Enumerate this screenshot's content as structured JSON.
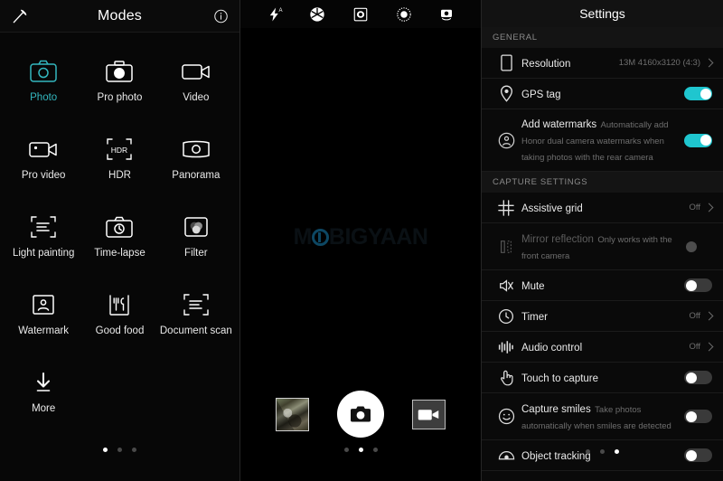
{
  "modes_panel": {
    "title": "Modes",
    "left_icon": "magic-wand-icon",
    "right_icon": "info-icon",
    "items": [
      {
        "label": "Photo",
        "icon": "camera-icon",
        "active": true
      },
      {
        "label": "Pro photo",
        "icon": "pro-camera-icon",
        "active": false
      },
      {
        "label": "Video",
        "icon": "video-camera-icon",
        "active": false
      },
      {
        "label": "Pro video",
        "icon": "pro-video-icon",
        "active": false
      },
      {
        "label": "HDR",
        "icon": "hdr-icon",
        "active": false
      },
      {
        "label": "Panorama",
        "icon": "panorama-icon",
        "active": false
      },
      {
        "label": "Light painting",
        "icon": "light-painting-icon",
        "active": false
      },
      {
        "label": "Time-lapse",
        "icon": "time-lapse-icon",
        "active": false
      },
      {
        "label": "Filter",
        "icon": "filter-icon",
        "active": false
      },
      {
        "label": "Watermark",
        "icon": "watermark-icon",
        "active": false
      },
      {
        "label": "Good food",
        "icon": "good-food-icon",
        "active": false
      },
      {
        "label": "Document scan",
        "icon": "document-scan-icon",
        "active": false
      },
      {
        "label": "More",
        "icon": "download-arrow-icon",
        "active": false
      }
    ],
    "page_dots": {
      "count": 3,
      "active_index": 0
    }
  },
  "viewfinder_panel": {
    "top_icons": [
      {
        "name": "flash-auto-icon",
        "label": "Flash auto"
      },
      {
        "name": "aperture-icon",
        "label": "Aperture"
      },
      {
        "name": "wide-aperture-icon",
        "label": "Wide aperture"
      },
      {
        "name": "beauty-icon",
        "label": "Beauty"
      },
      {
        "name": "switch-camera-icon",
        "label": "Switch camera"
      }
    ],
    "watermark_text_before": "M",
    "watermark_text_after": "BIGYAAN",
    "controls": {
      "gallery_thumb": "gallery-thumbnail",
      "shutter": "shutter-button",
      "video": "video-record-button"
    },
    "page_dots": {
      "count": 3,
      "active_index": 1
    }
  },
  "settings_panel": {
    "title": "Settings",
    "page_dots": {
      "count": 3,
      "active_index": 2
    },
    "sections": [
      {
        "header": "GENERAL",
        "rows": [
          {
            "icon": "resolution-icon",
            "title": "Resolution",
            "sub": "",
            "control": "value-chevron",
            "value": "13M 4160x3120 (4:3)",
            "state": "",
            "disabled": false
          },
          {
            "icon": "gps-pin-icon",
            "title": "GPS tag",
            "sub": "",
            "control": "toggle",
            "value": "",
            "state": "on",
            "disabled": false
          },
          {
            "icon": "watermark-person-icon",
            "title": "Add watermarks",
            "sub": "Automatically add Honor dual camera watermarks when taking photos with the rear camera",
            "control": "toggle",
            "value": "",
            "state": "on",
            "disabled": false
          }
        ]
      },
      {
        "header": "CAPTURE SETTINGS",
        "rows": [
          {
            "icon": "grid-icon",
            "title": "Assistive grid",
            "sub": "",
            "control": "value-chevron",
            "value": "Off",
            "state": "",
            "disabled": false
          },
          {
            "icon": "mirror-icon",
            "title": "Mirror reflection",
            "sub": "Only works with the front camera",
            "control": "toggle-dim",
            "value": "",
            "state": "off",
            "disabled": true
          },
          {
            "icon": "mute-icon",
            "title": "Mute",
            "sub": "",
            "control": "toggle",
            "value": "",
            "state": "off",
            "disabled": false
          },
          {
            "icon": "clock-icon",
            "title": "Timer",
            "sub": "",
            "control": "value-chevron",
            "value": "Off",
            "state": "",
            "disabled": false
          },
          {
            "icon": "audio-control-icon",
            "title": "Audio control",
            "sub": "",
            "control": "value-chevron",
            "value": "Off",
            "state": "",
            "disabled": false
          },
          {
            "icon": "touch-icon",
            "title": "Touch to capture",
            "sub": "",
            "control": "toggle",
            "value": "",
            "state": "off",
            "disabled": false
          },
          {
            "icon": "smile-icon",
            "title": "Capture smiles",
            "sub": "Take photos automatically when smiles are detected",
            "control": "toggle",
            "value": "",
            "state": "off",
            "disabled": false
          },
          {
            "icon": "object-tracking-icon",
            "title": "Object tracking",
            "sub": "",
            "control": "toggle",
            "value": "",
            "state": "off",
            "disabled": false
          }
        ]
      }
    ]
  },
  "colors": {
    "accent_teal": "#1fc6cf",
    "mode_active": "#33b7bf",
    "panel_bg": "#0a0a0a",
    "text_primary": "#eaeaea",
    "text_secondary": "#6e6e6e"
  }
}
